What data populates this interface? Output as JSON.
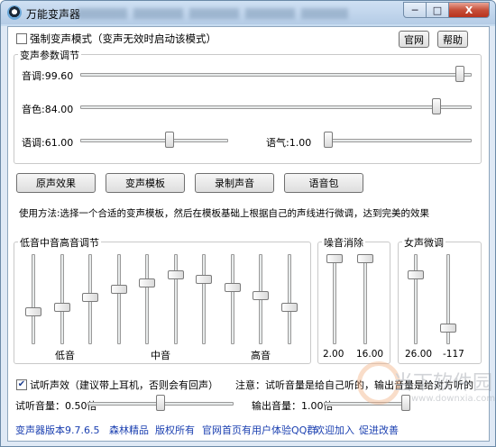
{
  "window": {
    "title": "万能变声器",
    "min": "─",
    "max": "□",
    "close": "X"
  },
  "top": {
    "force_mode_label": "强制变声模式（变声无效时启动该模式）",
    "force_mode_checked": false,
    "site_button": "官网",
    "help_button": "帮助"
  },
  "params": {
    "group_title": "变声参数调节",
    "pitch_label": "音调:99.60",
    "pitch_level": 0.98,
    "timbre_label": "音色:84.00",
    "timbre_level": 0.92,
    "speed_label": "语调:61.00",
    "speed_level": 0.61,
    "breath_label": "语气:1.00",
    "breath_level": 0.0
  },
  "buttons": {
    "original": "原声效果",
    "templates": "变声模板",
    "record": "录制声音",
    "voice_pack": "语音包"
  },
  "usage_text": "使用方法:选择一个合适的变声模板，然后在模板基础上根据自己的声线进行微调，达到完美的效果",
  "eq": {
    "group_title": "低音中音高音调节",
    "low_label": "低音",
    "mid_label": "中音",
    "high_label": "高音",
    "levels": [
      0.35,
      0.4,
      0.52,
      0.62,
      0.7,
      0.8,
      0.75,
      0.65,
      0.55,
      0.4
    ]
  },
  "noise": {
    "group_title": "噪音消除",
    "val1": "2.00",
    "val2": "16.00",
    "levels": [
      1.0,
      1.0
    ]
  },
  "female": {
    "group_title": "女声微调",
    "val1": "26.00",
    "val2": "-117",
    "levels": [
      0.8,
      0.15
    ]
  },
  "listen": {
    "checkbox_label": "试听声效（建议带上耳机，否则会有回声）",
    "checked": true,
    "note": "注意：试听音量是给自己听的，输出音量是给对方听的",
    "volume_label": "试听音量：0.50倍",
    "volume_level": 0.5,
    "output_label": "输出音量：1.00倍",
    "output_level": 1.0
  },
  "footer": {
    "version": "变声器版本9.7.6.5",
    "author": "森林精品",
    "rights": "版权所有",
    "promo": "官网首页有用户体验QQ群",
    "welcome": "欢迎加入",
    "suggest": "促进改善"
  },
  "watermark": {
    "text": "当下软件园",
    "url": "www.downxia.com"
  }
}
